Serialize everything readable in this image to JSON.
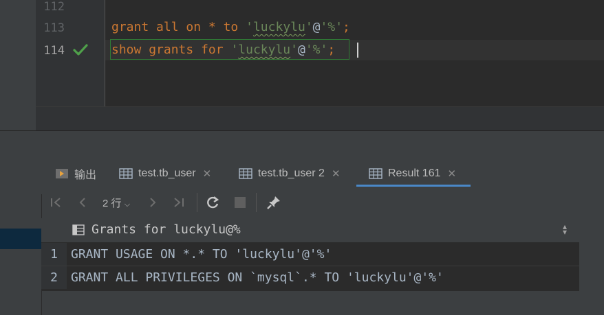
{
  "editor": {
    "line_numbers": [
      "112",
      "113",
      "114"
    ],
    "line113": {
      "t1": "grant",
      "t2": " ",
      "t3": "all",
      "t4": " ",
      "t5": "on",
      "t6": " * ",
      "t7": "to",
      "t8": " ",
      "s1": "'",
      "s2": "luckylu",
      "s3": "'",
      "t9": "@",
      "s4": "'%'",
      "t10": ";"
    },
    "line114": {
      "t1": "show",
      "t2": " ",
      "t3": "grants",
      "t4": " ",
      "t5": "for",
      "t6": " ",
      "s1": "'",
      "s2": "luckylu",
      "s3": "'",
      "t9": "@",
      "s4": "'%'",
      "t10": ";"
    }
  },
  "tabs": [
    {
      "label": "输出",
      "icon": "console-icon",
      "closable": false
    },
    {
      "label": "test.tb_user",
      "icon": "table-icon",
      "closable": true
    },
    {
      "label": "test.tb_user 2",
      "icon": "table-icon",
      "closable": true
    },
    {
      "label": "Result 161",
      "icon": "table-icon",
      "closable": true,
      "active": true
    }
  ],
  "toolbar": {
    "first_icon": "⏮",
    "prev_icon": "‹",
    "rows_label": "2 行",
    "next_icon": "›",
    "last_icon": "⏭",
    "reload_icon": "↻",
    "stop_icon": "■",
    "pin_icon": "📌"
  },
  "grid": {
    "column": "Grants for luckylu@%",
    "rows": [
      {
        "num": "1",
        "value": "GRANT USAGE ON *.* TO 'luckylu'@'%'"
      },
      {
        "num": "2",
        "value": "GRANT ALL PRIVILEGES ON `mysql`.* TO 'luckylu'@'%'"
      }
    ]
  },
  "colors": {
    "keyword": "#cc7832",
    "string": "#6a8759",
    "accent": "#4a88c7",
    "success": "#4fa04a"
  }
}
